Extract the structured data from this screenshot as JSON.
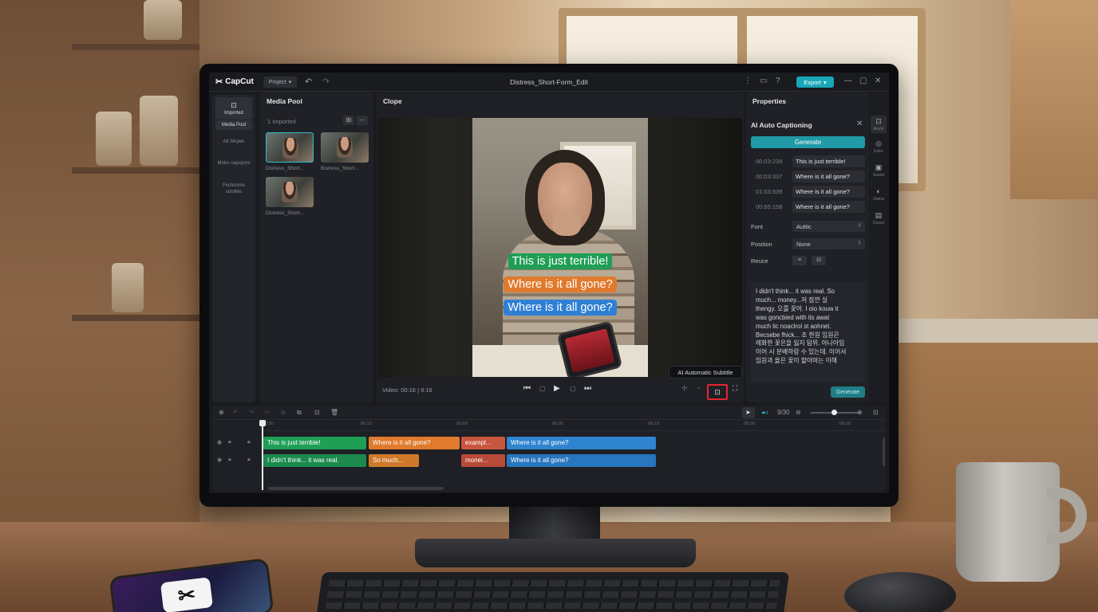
{
  "app": {
    "logo": "CapCut",
    "project_button": "Project",
    "window_title": "Distress_Short-Form_Edit",
    "export_label": "Export"
  },
  "left_nav": [
    {
      "label": "Imported",
      "icon": "import-icon"
    },
    {
      "label": "Media Pool"
    },
    {
      "label": "All Sinpen"
    },
    {
      "label": "Moior capcpcre"
    },
    {
      "label": "Fecticome sololtes"
    }
  ],
  "media_pool": {
    "title": "Media Pool",
    "count": "1 Imported",
    "items": [
      "Distress_Short...",
      "Bistress_Short...",
      "Distress_Short..."
    ]
  },
  "player": {
    "title": "Clope",
    "video_info": "Video: 00:16 | 9:16",
    "captions": [
      "This is just terrible!",
      "Where is it all gone?",
      "Where is it all gone?"
    ],
    "tooltip": "AI Automatic Subtitle"
  },
  "properties": {
    "title": "Properties",
    "panel_title": "AI Auto Captioning",
    "generate_label": "Generate",
    "caption_rows": [
      {
        "time": "00:03:239",
        "text": "This is just terrible!"
      },
      {
        "time": "00:03:337",
        "text": "Where is it all gone?"
      },
      {
        "time": "01:03:939",
        "text": "Where is it all gone?"
      },
      {
        "time": "00:65:158",
        "text": "Where is it all gone?"
      }
    ],
    "font_label": "Font",
    "font_value": "Auttic",
    "position_label": "Position",
    "position_value": "None",
    "reuse_label": "Reuce",
    "transcript_lines": [
      "I didn't think... it was real. So",
      "much... money...저 잠깐 실",
      "thengy. 오를 꽃어. I oio kouw it",
      "was goncbied with its awat",
      "much lic noaclrol st aohnet.",
      "Becsebe fhick... 조 한원 임원끈",
      "레화한 꽃은을 잃지 탐위. 아나아입",
      "이어 시 분배하랑 수 있는데. 이어서",
      "임원과 옳은 꽃이 할아마는 이해"
    ],
    "generate2_label": "Generate"
  },
  "right_nav": [
    {
      "label": "Anchi",
      "icon": "caption-icon"
    },
    {
      "label": "Extre",
      "icon": "effects-icon"
    },
    {
      "label": "Sound",
      "icon": "sound-icon"
    },
    {
      "label": "Dama",
      "icon": "filter-icon"
    },
    {
      "label": "Cosoo",
      "icon": "adjust-icon"
    }
  ],
  "timeline": {
    "zoom_readout": "9/30",
    "ticks": [
      "0:30",
      "00:10",
      "00:00",
      "00:00",
      "00:10",
      "00:00",
      "00:00"
    ],
    "track1": [
      "This is just terrible!",
      "Where is it all gone?",
      "exampl...",
      "Where is it all gone?"
    ],
    "track2": [
      "I didn't think... it was real.",
      "So much...",
      "monei...",
      "Where is it all gone?"
    ]
  }
}
